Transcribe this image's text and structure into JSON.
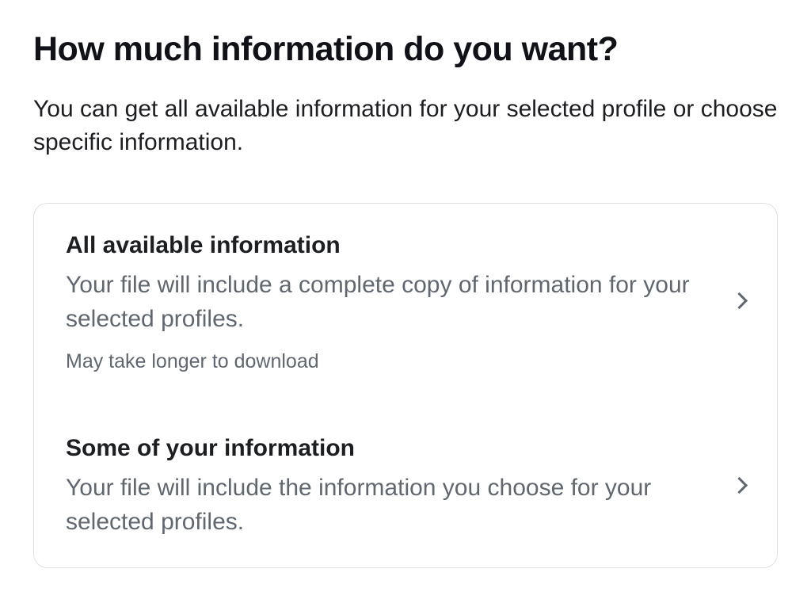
{
  "page": {
    "title": "How much information do you want?",
    "subtitle": "You can get all available information for your selected profile or choose specific information."
  },
  "options": [
    {
      "title": "All available information",
      "description": "Your file will include a complete copy of information for your selected profiles.",
      "note": "May take longer to download"
    },
    {
      "title": "Some of your information",
      "description": "Your file will include the information you choose for your selected profiles."
    }
  ]
}
